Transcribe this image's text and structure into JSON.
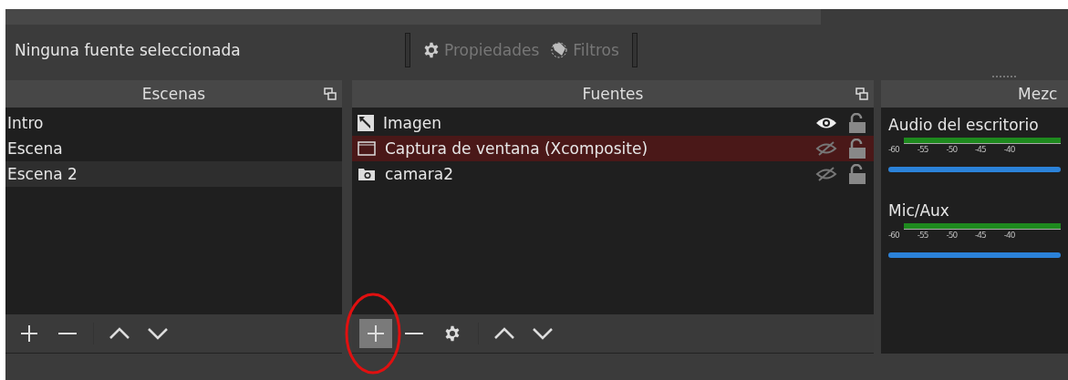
{
  "toolbar": {
    "status": "Ninguna fuente seleccionada",
    "buttons": [
      {
        "kind": "properties",
        "label": "Propiedades",
        "disabled": true
      },
      {
        "kind": "filters",
        "label": "Filtros",
        "disabled": true
      }
    ]
  },
  "scenes": {
    "title": "Escenas",
    "items": [
      {
        "label": "Intro",
        "selected": false
      },
      {
        "label": "Escena",
        "selected": false
      },
      {
        "label": "Escena 2",
        "selected": true
      }
    ],
    "buttons": [
      {
        "kind": "add",
        "hovered": false
      },
      {
        "kind": "remove",
        "hovered": false
      },
      {
        "kind": "sep"
      },
      {
        "kind": "up",
        "hovered": false
      },
      {
        "kind": "down",
        "hovered": false
      }
    ]
  },
  "sources": {
    "title": "Fuentes",
    "items": [
      {
        "label": "Imagen",
        "kind": "image",
        "visible": true,
        "selected": false
      },
      {
        "label": "Captura de ventana (Xcomposite)",
        "kind": "window",
        "visible": false,
        "selected": true
      },
      {
        "label": "camara2",
        "kind": "camera",
        "visible": false,
        "selected": false
      }
    ],
    "buttons": [
      {
        "kind": "add",
        "hovered": true
      },
      {
        "kind": "remove",
        "hovered": false
      },
      {
        "kind": "settings",
        "hovered": false
      },
      {
        "kind": "sep"
      },
      {
        "kind": "up",
        "hovered": false
      },
      {
        "kind": "down",
        "hovered": false
      }
    ]
  },
  "mixer": {
    "title": "Mezc",
    "channels": [
      {
        "name": "Audio del escritorio",
        "scale": [
          "-60",
          "-55",
          "-50",
          "-45",
          "-40"
        ],
        "level": 1
      },
      {
        "name": "Mic/Aux",
        "scale": [
          "-60",
          "-55",
          "-50",
          "-45",
          "-40"
        ],
        "level": 1
      }
    ]
  }
}
